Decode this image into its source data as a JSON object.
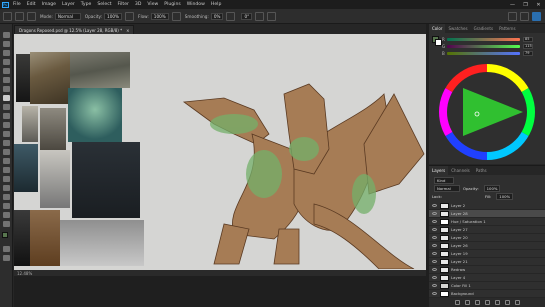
{
  "app": {
    "logo": "Ps"
  },
  "menu": [
    "File",
    "Edit",
    "Image",
    "Layer",
    "Type",
    "Select",
    "Filter",
    "3D",
    "View",
    "Plugins",
    "Window",
    "Help"
  ],
  "window_controls": [
    "—",
    "❐",
    "✕"
  ],
  "options": {
    "mode_label": "Mode:",
    "mode_value": "Normal",
    "opacity_label": "Opacity:",
    "opacity_value": "100%",
    "flow_label": "Flow:",
    "flow_value": "100%",
    "smoothing_label": "Smoothing:",
    "smoothing_value": "0%",
    "angle_value": "0°"
  },
  "document": {
    "tab_title": "Dragons Reposed.psd @ 12.5% (Layer 28, RGB/8) *",
    "close": "×",
    "zoom": "12.48%"
  },
  "color_panel": {
    "tabs": [
      "Color",
      "Swatches",
      "Gradients",
      "Patterns"
    ],
    "sliders": [
      {
        "label": "R",
        "value": "85"
      },
      {
        "label": "G",
        "value": "115"
      },
      {
        "label": "B",
        "value": "79"
      }
    ],
    "fg": "#58764f",
    "bg": "#ffffff"
  },
  "layers_panel": {
    "tabs": [
      "Layers",
      "Channels",
      "Paths"
    ],
    "kind": "Kind",
    "blend": "Normal",
    "opacity_label": "Opacity:",
    "opacity_value": "100%",
    "lock_label": "Lock:",
    "fill_label": "Fill:",
    "fill_value": "100%",
    "rows": [
      "Layer 2",
      "Layer 28",
      "Hue / Saturation 1",
      "Layer 27",
      "Layer 20",
      "Layer 26",
      "Layer 19",
      "Layer 21",
      "Redraw",
      "Layer 4",
      "Color Fill 1",
      "Background"
    ]
  }
}
